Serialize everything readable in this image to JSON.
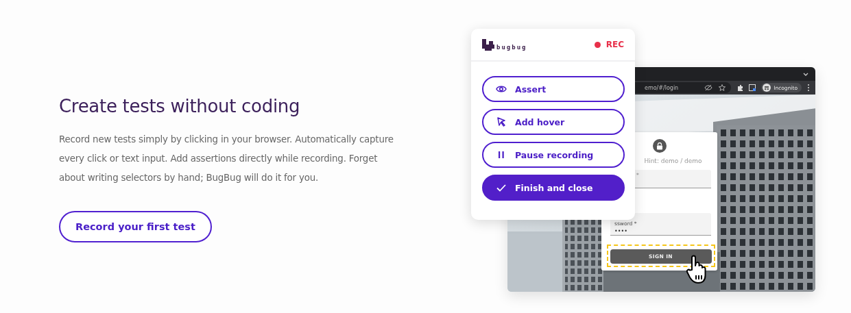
{
  "feature": {
    "heading": "Create tests without coding",
    "body": "Record new tests simply by clicking in your browser. Automatically capture every click or text input. Add assertions directly while recording. Forget about writing selectors by hand; BugBug will do it for you.",
    "cta": "Record your first test"
  },
  "recorder": {
    "logo_text": "bugbug",
    "status": "REC",
    "recording": true,
    "actions": [
      {
        "label": "Assert",
        "kind": "eye",
        "filled": false
      },
      {
        "label": "Add hover",
        "kind": "cursor",
        "filled": false
      },
      {
        "label": "Pause recording",
        "kind": "pause",
        "filled": false
      },
      {
        "label": "Finish and close",
        "kind": "check",
        "filled": true
      }
    ]
  },
  "browser": {
    "address": "emo/#/login",
    "profile": "Incognito",
    "login": {
      "hint": "Hint: demo / demo",
      "fields": [
        {
          "label": "*"
        },
        {
          "label": "ssword *",
          "value": "••••"
        }
      ],
      "submit": {
        "label": "SIGN IN",
        "highlighted": true
      }
    }
  }
}
